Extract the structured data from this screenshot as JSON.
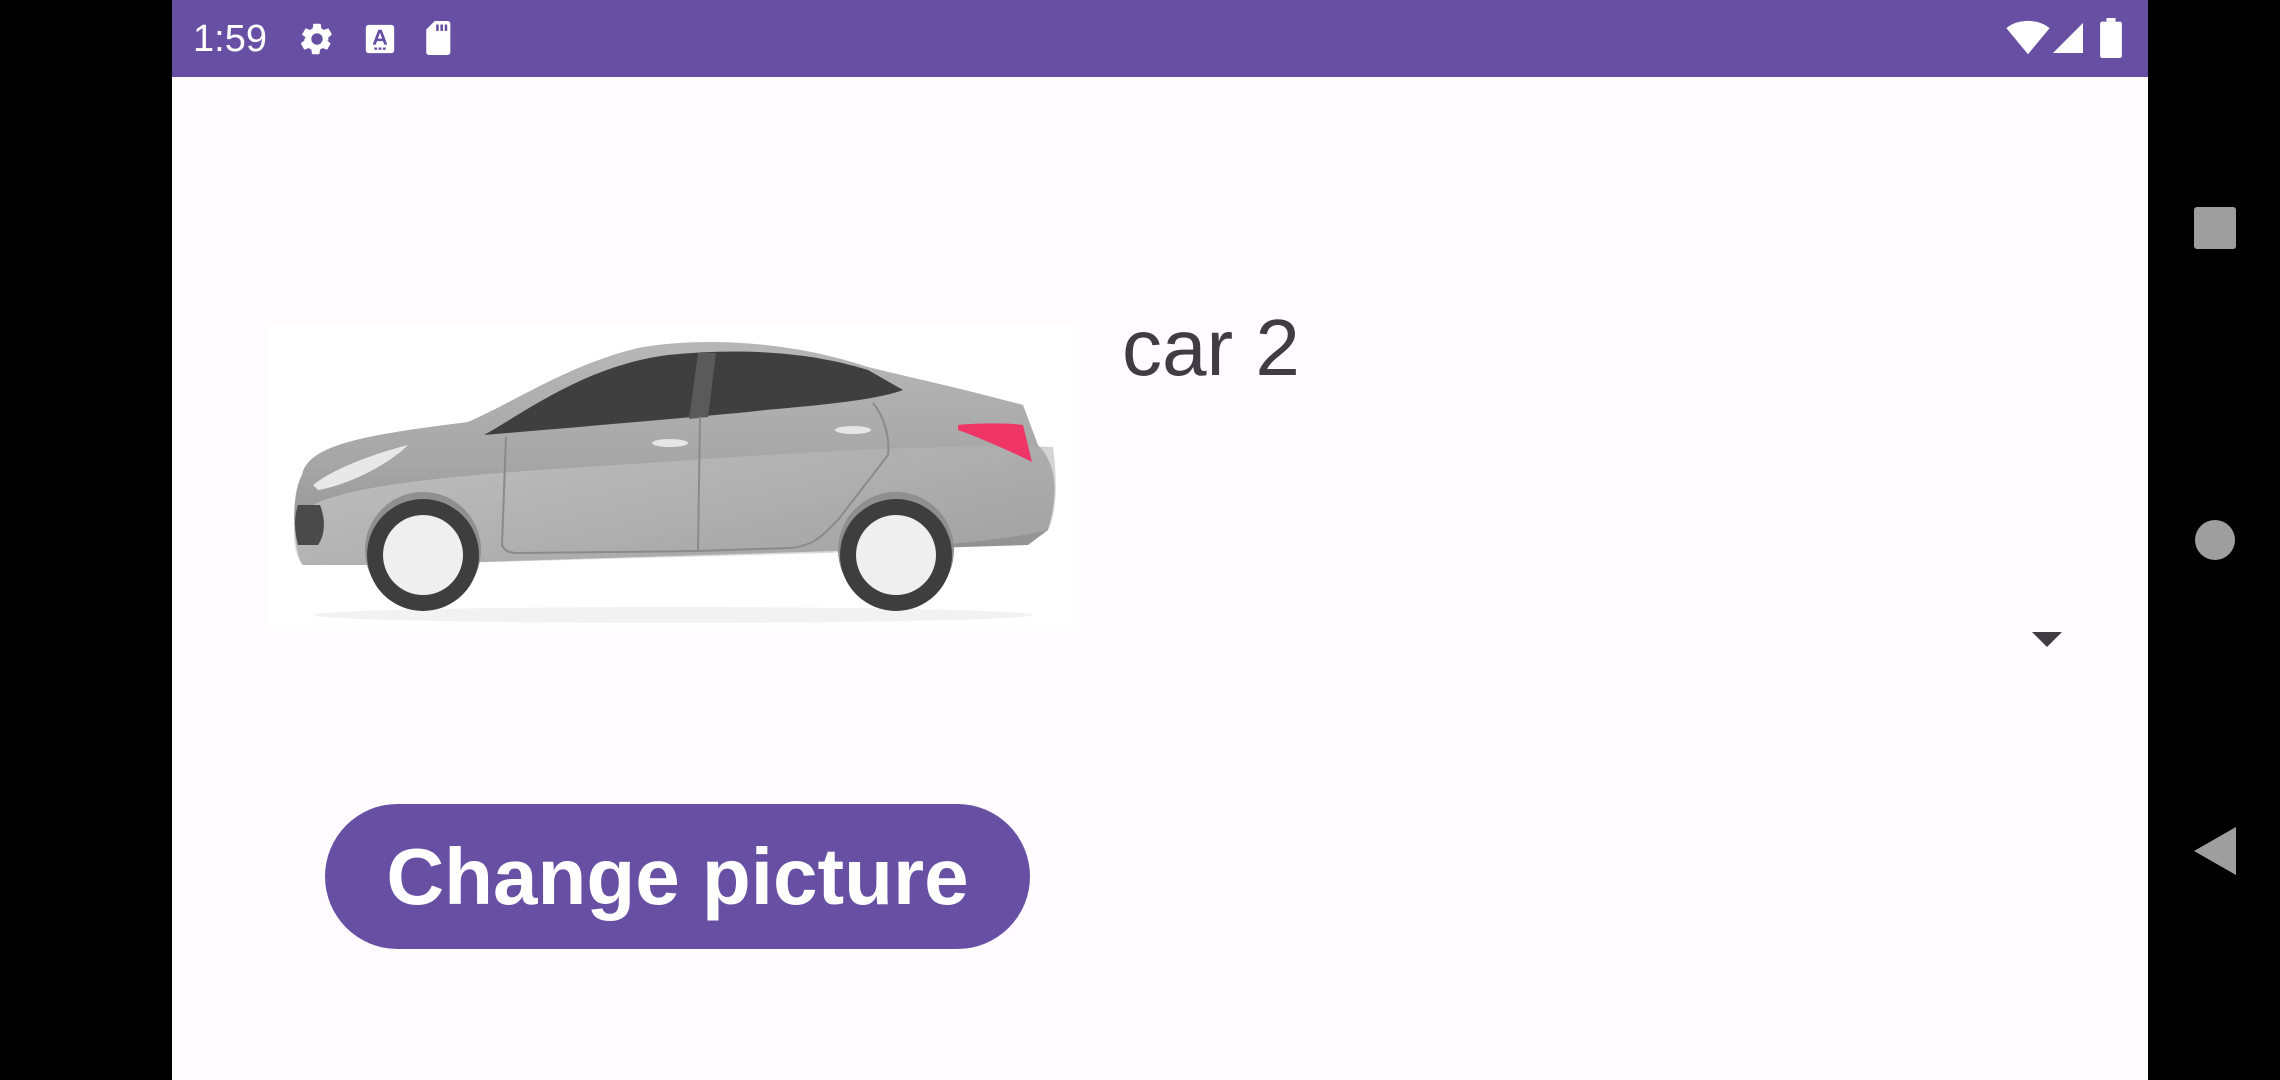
{
  "status_bar": {
    "time": "1:59",
    "left_icons": [
      "gear-icon",
      "text-a-icon",
      "sd-card-icon"
    ],
    "right_icons": [
      "wifi-icon",
      "cell-signal-icon",
      "battery-icon"
    ]
  },
  "main": {
    "image_icon": "car-icon",
    "car_name": "car 2",
    "spinner_icon": "dropdown-arrow-icon",
    "change_picture_label": "Change picture"
  },
  "nav_bar": {
    "icons": [
      "recents-square-icon",
      "home-circle-icon",
      "back-triangle-icon"
    ]
  },
  "colors": {
    "accent": "#6750a4",
    "background": "#fffbfe",
    "text": "#3f3d43",
    "car_body": "#a9a9a9",
    "taillight": "#ef3466"
  }
}
